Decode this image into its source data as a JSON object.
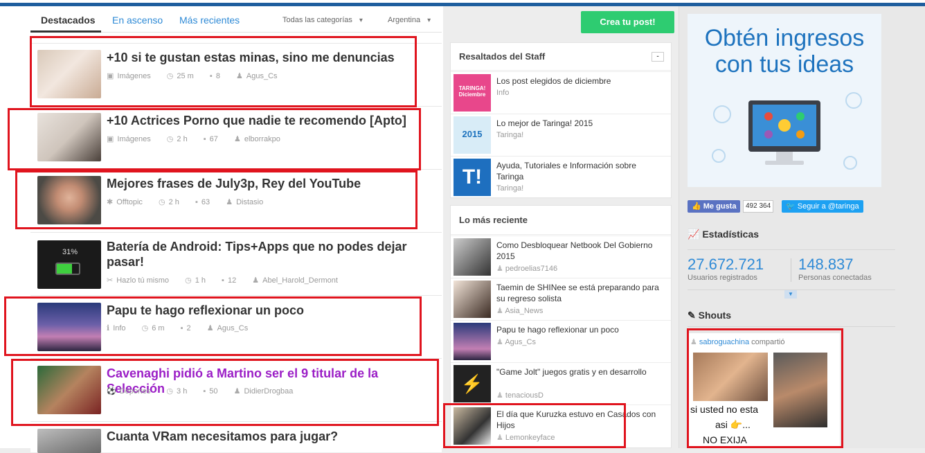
{
  "tabs": [
    "Destacados",
    "En ascenso",
    "Más recientes"
  ],
  "filters": {
    "category": "Todas las categorías",
    "country": "Argentina"
  },
  "posts": [
    {
      "title": "+10 si te gustan estas minas, sino me denuncias",
      "category": "Imágenes",
      "time": "25 m",
      "comments": "8",
      "user": "Agus_Cs"
    },
    {
      "title": "+10 Actrices Porno que nadie te recomendo [Apto]",
      "category": "Imágenes",
      "time": "2 h",
      "comments": "67",
      "user": "elborrakpo"
    },
    {
      "title": "Mejores frases de July3p, Rey del YouTube",
      "category": "Offtopic",
      "time": "2 h",
      "comments": "63",
      "user": "Distasio"
    },
    {
      "title": "Batería de Android: Tips+Apps que no podes dejar pasar!",
      "category": "Hazlo tú mismo",
      "time": "1 h",
      "comments": "12",
      "user": "Abel_Harold_Dermont",
      "thumb_text": "31%"
    },
    {
      "title": "Papu te hago reflexionar un poco",
      "category": "Info",
      "time": "6 m",
      "comments": "2",
      "user": "Agus_Cs"
    },
    {
      "title": "Cavenaghi pidió a Martino ser el 9 titular de la Selección",
      "category": "Deportes",
      "time": "3 h",
      "comments": "50",
      "user": "DidierDrogbaa"
    },
    {
      "title": "Cuanta VRam necesitamos para jugar?"
    }
  ],
  "create_button": "Crea tu post!",
  "staff": {
    "heading": "Resaltados del Staff",
    "collapse": "-",
    "items": [
      {
        "title": "Los post elegidos de diciembre",
        "sub": "Info",
        "thumb_text": "TARINGA! Diciembre"
      },
      {
        "title": "Lo mejor de Taringa! 2015",
        "sub": "Taringa!",
        "thumb_text": "2015"
      },
      {
        "title": "Ayuda, Tutoriales e Información sobre Taringa",
        "sub": "Taringa!",
        "thumb_text": "T!"
      }
    ]
  },
  "recent": {
    "heading": "Lo más reciente",
    "items": [
      {
        "title": "Como Desbloquear Netbook Del Gobierno 2015",
        "user": "pedroelias7146"
      },
      {
        "title": "Taemin de SHINee se está preparando para su regreso solista",
        "user": "Asia_News"
      },
      {
        "title": "Papu te hago reflexionar un poco",
        "user": "Agus_Cs"
      },
      {
        "title": "\"Game Jolt\" juegos gratis y en desarrollo",
        "user": "tenaciousD"
      },
      {
        "title": "El día que Kuruzka estuvo en Casados con Hijos",
        "user": "Lemonkeyface"
      }
    ]
  },
  "ad": {
    "title": "Obtén ingresos con tus ideas"
  },
  "social": {
    "fb_label": "Me gusta",
    "fb_count": "492 364",
    "tw_label": "Seguir a @taringa"
  },
  "stats": {
    "heading": "Estadísticas",
    "users_num": "27.672.721",
    "users_label": "Usuarios registrados",
    "online_num": "148.837",
    "online_label": "Personas conectadas"
  },
  "shouts": {
    "heading": "Shouts",
    "user": "sabroguachina",
    "action": "compartió",
    "image_text_1": "si usted no esta",
    "image_text_2": "asi 👉...",
    "image_text_3": "NO EXIJA"
  },
  "colors": {
    "accent": "#2e8ad6",
    "red_annotation": "#e0141e",
    "green": "#2ecc71",
    "purple": "#9b1ec6"
  }
}
